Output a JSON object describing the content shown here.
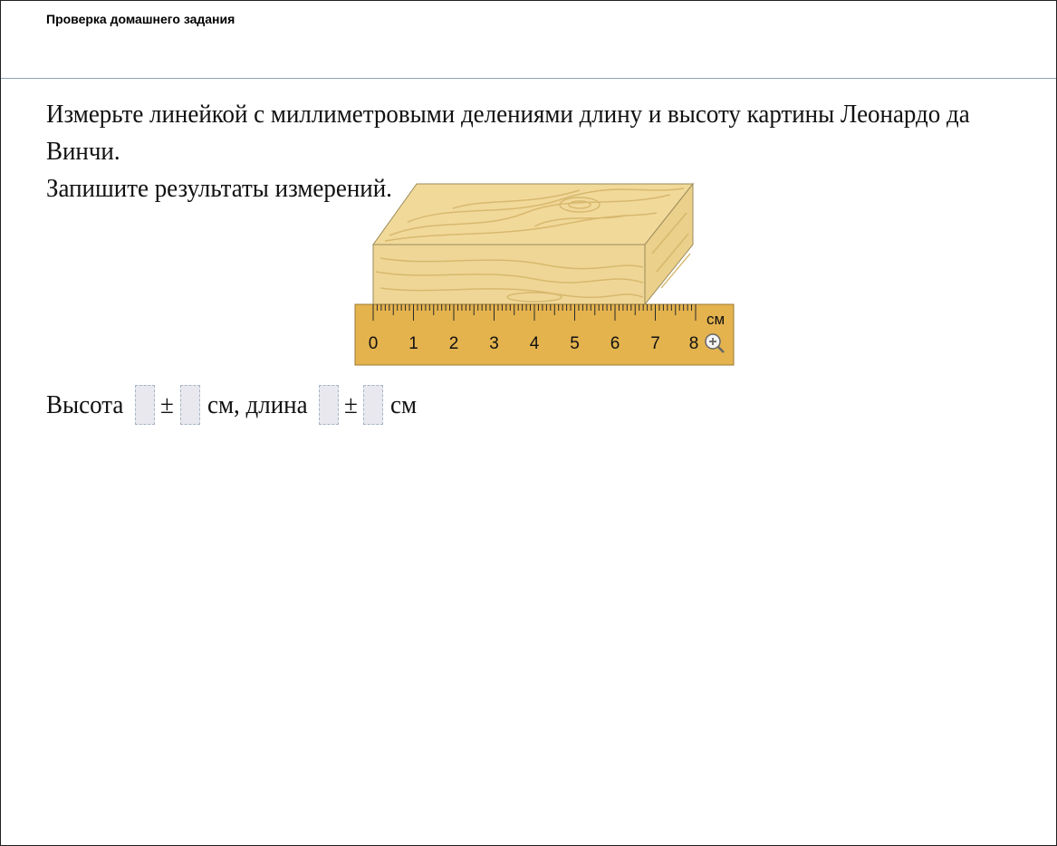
{
  "header": {
    "title": "Проверка домашнего задания"
  },
  "task": {
    "line1": "Измерьте линейкой с миллиметровыми делениями длину и высоту картины Леонардо да Винчи.",
    "line2": "Запишите результаты измерений."
  },
  "ruler": {
    "unit": "см",
    "labels": [
      "0",
      "1",
      "2",
      "3",
      "4",
      "5",
      "6",
      "7",
      "8"
    ],
    "zoom_icon": "zoom-in-icon"
  },
  "answer": {
    "height_label": "Высота",
    "pm1": "±",
    "unit_length_label": "см, длина",
    "pm2": "±",
    "unit_end": "см",
    "height_value": "",
    "height_error": "",
    "length_value": "",
    "length_error": ""
  },
  "colors": {
    "ruler": "#e4b34e",
    "wood_light": "#f3dca0",
    "wood_dark": "#d9b96a"
  }
}
